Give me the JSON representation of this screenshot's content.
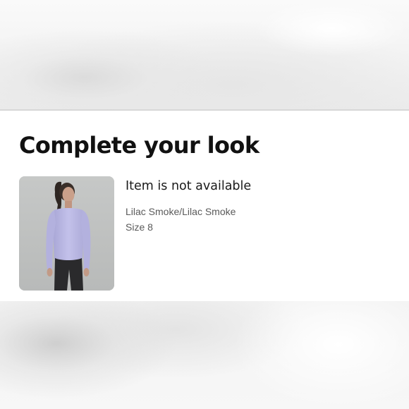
{
  "section": {
    "title": "Complete your look"
  },
  "product": {
    "status": "Item is not available",
    "color": "Lilac Smoke/Lilac Smoke",
    "size": "Size 8",
    "image_subject": "model wearing long-sleeve lilac top and black leggings"
  },
  "colors": {
    "background": "#ffffff",
    "title_text": "#111111",
    "meta_text": "#5a5a5a",
    "divider": "#d7d7d7",
    "product_lilac": "#b9b7e0",
    "image_backdrop": "#c2c4c3"
  }
}
